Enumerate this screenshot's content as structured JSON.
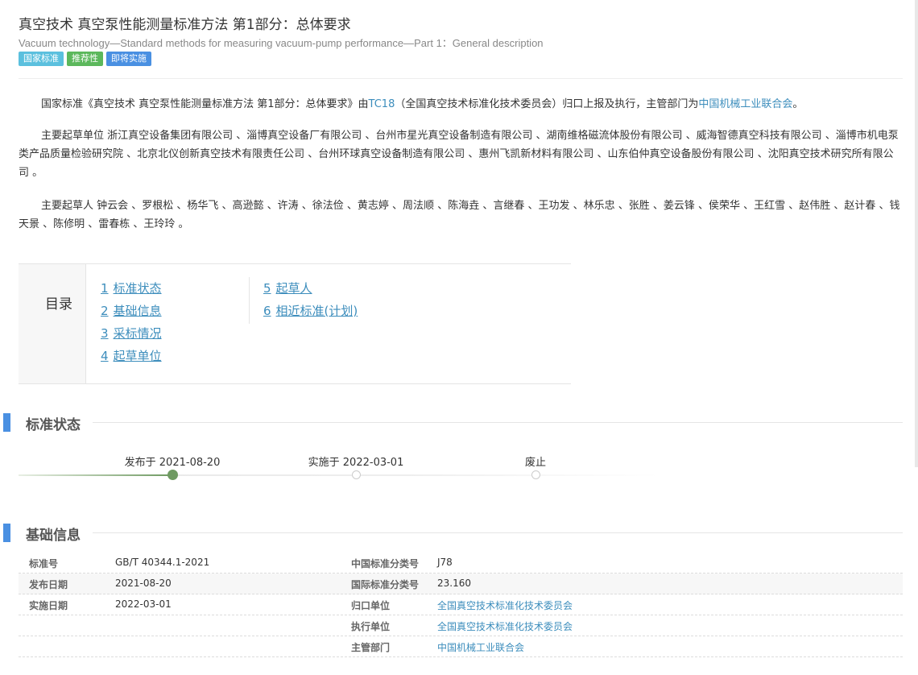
{
  "header": {
    "title": "真空技术 真空泵性能测量标准方法 第1部分：总体要求",
    "subtitle": "Vacuum technology—Standard methods for measuring vacuum-pump performance—Part 1：General description",
    "badges": [
      "国家标准",
      "推荐性",
      "即将实施"
    ]
  },
  "intro": {
    "p1_prefix": "国家标准《真空技术 真空泵性能测量标准方法 第1部分：总体要求》由",
    "p1_tc": "TC18",
    "p1_middle": "（全国真空技术标准化技术委员会）归口上报及执行，主管部门为",
    "p1_dept": "中国机械工业联合会",
    "p1_suffix": "。",
    "p2": "主要起草单位 浙江真空设备集团有限公司 、淄博真空设备厂有限公司 、台州市星光真空设备制造有限公司 、湖南维格磁流体股份有限公司 、威海智德真空科技有限公司 、淄博市机电泵类产品质量检验研究院 、北京北仪创新真空技术有限责任公司 、台州环球真空设备制造有限公司 、惠州飞凯新材料有限公司 、山东伯仲真空设备股份有限公司 、沈阳真空技术研究所有限公司 。",
    "p3": "主要起草人 钟云会 、罗根松 、杨华飞 、高逊懿 、许涛 、徐法俭 、黄志婷 、周法顺 、陈海垚 、言继春 、王功发 、林乐忠 、张胜 、姜云锋 、侯荣华 、王红雪 、赵伟胜 、赵计春 、钱天景 、陈修明 、雷春栋 、王玲玲 。"
  },
  "toc": {
    "label": "目录",
    "col1": [
      {
        "num": "1",
        "text": "标准状态"
      },
      {
        "num": "2",
        "text": "基础信息"
      },
      {
        "num": "3",
        "text": "采标情况"
      },
      {
        "num": "4",
        "text": "起草单位"
      }
    ],
    "col2": [
      {
        "num": "5",
        "text": "起草人"
      },
      {
        "num": "6",
        "text": "相近标准(计划)"
      }
    ]
  },
  "status_section": {
    "title": "标准状态",
    "steps": [
      {
        "label": "发布于 2021-08-20",
        "done": true
      },
      {
        "label": "实施于 2022-03-01",
        "done": false
      },
      {
        "label": "废止",
        "done": false
      }
    ]
  },
  "basic_section": {
    "title": "基础信息",
    "rows": [
      {
        "k1": "标准号",
        "v1": "GB/T 40344.1-2021",
        "k2": "中国标准分类号",
        "v2": "J78",
        "v2_link": false
      },
      {
        "k1": "发布日期",
        "v1": "2021-08-20",
        "k2": "国际标准分类号",
        "v2": "23.160",
        "v2_link": false
      },
      {
        "k1": "实施日期",
        "v1": "2022-03-01",
        "k2": "归口单位",
        "v2": "全国真空技术标准化技术委员会",
        "v2_link": true
      },
      {
        "k1": "",
        "v1": "",
        "k2": "执行单位",
        "v2": "全国真空技术标准化技术委员会",
        "v2_link": true
      },
      {
        "k1": "",
        "v1": "",
        "k2": "主管部门",
        "v2": "中国机械工业联合会",
        "v2_link": true
      }
    ]
  },
  "colors": {
    "accent": "#4a90e2",
    "link": "#3c8dbc",
    "badge_national": "#5bc0de",
    "badge_recommended": "#5cb85c",
    "badge_upcoming": "#4a90e2",
    "timeline_done": "#6f9a62"
  }
}
